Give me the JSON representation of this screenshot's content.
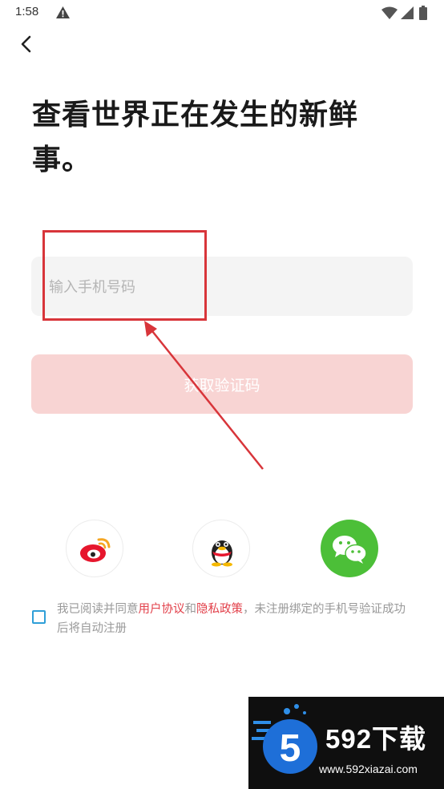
{
  "status_bar": {
    "time": "1:58"
  },
  "header": {
    "title": "查看世界正在发生的新鲜事。"
  },
  "phone_field": {
    "placeholder": "输入手机号码",
    "value": ""
  },
  "get_code_button": {
    "label": "获取验证码"
  },
  "social_login": {
    "icons": [
      "weibo-icon",
      "qq-icon",
      "wechat-icon"
    ]
  },
  "agreement": {
    "prefix": "我已阅读并同意",
    "user_agreement": "用户协议",
    "and": "和",
    "privacy_policy": "隐私政策",
    "suffix": "，未注册绑定的手机号验证成功后将自动注册",
    "checked": false
  },
  "watermark": {
    "brand": "592下载",
    "url": "www.592xiazai.com"
  },
  "colors": {
    "accent_red": "#e2404a",
    "button_disabled": "#f8d4d3",
    "field_bg": "#f4f4f4",
    "wechat_green": "#4cbf38",
    "checkbox_blue": "#2f9fd8",
    "annotation_red": "#d8353a"
  }
}
